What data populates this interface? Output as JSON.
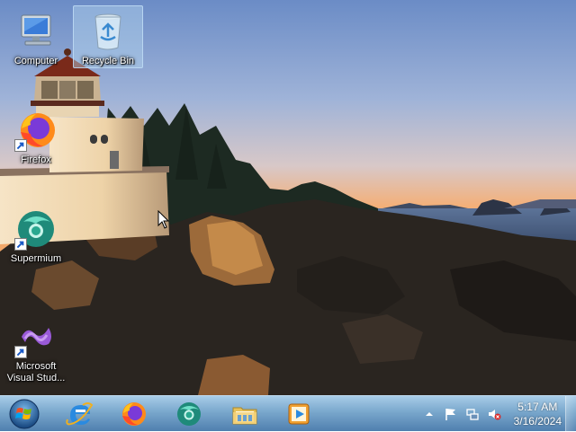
{
  "desktop": {
    "icons": [
      {
        "label": "Computer",
        "icon": "computer-icon",
        "selected": false
      },
      {
        "label": "Recycle Bin",
        "icon": "recycle-bin-icon",
        "selected": true
      },
      {
        "label": "Firefox",
        "icon": "firefox-icon",
        "selected": false
      },
      {
        "label": "Supermium",
        "icon": "supermium-icon",
        "selected": false
      },
      {
        "label": "Microsoft Visual Stud...",
        "icon": "visual-studio-icon",
        "selected": false
      }
    ]
  },
  "taskbar": {
    "start_icon": "windows-start-orb",
    "pinned": [
      {
        "name": "Internet Explorer",
        "icon": "internet-explorer-icon"
      },
      {
        "name": "Firefox",
        "icon": "firefox-icon"
      },
      {
        "name": "Supermium",
        "icon": "supermium-icon"
      },
      {
        "name": "Windows Explorer",
        "icon": "folder-icon"
      },
      {
        "name": "Windows Media Player",
        "icon": "media-player-icon"
      }
    ],
    "tray": {
      "icons": [
        "show-hidden-icons-arrow",
        "action-center-flag-icon",
        "network-icon",
        "volume-muted-icon"
      ],
      "time": "5:17 AM",
      "date": "3/16/2024"
    }
  },
  "colors": {
    "taskbar_top": "#a0c8e6",
    "taskbar_bottom": "#4678aa",
    "sky_top": "#6f8fc4",
    "sky_horizon": "#f3b07a"
  }
}
